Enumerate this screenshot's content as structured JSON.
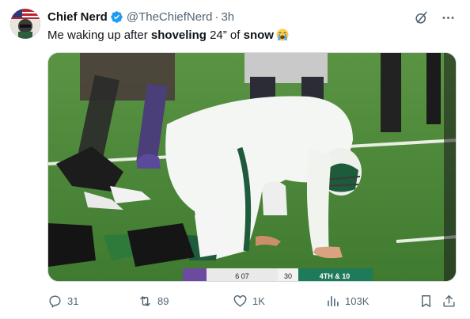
{
  "tweet": {
    "display_name": "Chief Nerd",
    "handle": "@TheChiefNerd",
    "separator": "·",
    "time": "3h",
    "text_parts": {
      "p1": "Me waking up after ",
      "p2": "shoveling",
      "p3": " 24” of ",
      "p4": "snow"
    },
    "emoji": "loudly-crying-face"
  },
  "media": {
    "scoreboard": {
      "left_text": "6 07",
      "mid_text": "30",
      "down_text": "4TH & 10"
    }
  },
  "actions": {
    "replies": "31",
    "reposts": "89",
    "likes": "1K",
    "views": "103K"
  },
  "colors": {
    "verified_blue": "#1d9bf0",
    "secondary_text": "#536471",
    "jets_green": "#1d5b3a"
  },
  "icons": [
    "grok-icon",
    "more-icon",
    "reply-icon",
    "repost-icon",
    "like-icon",
    "views-icon",
    "bookmark-icon",
    "share-icon"
  ]
}
